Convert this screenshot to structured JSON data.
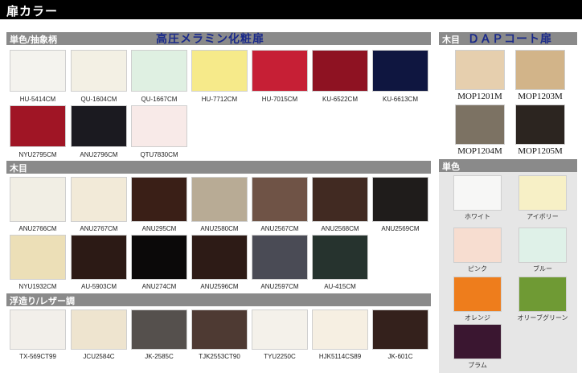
{
  "header": {
    "title": "扉カラー"
  },
  "melamine": {
    "label": "単色/抽象柄",
    "title": "高圧メラミン化粧扉",
    "items": [
      {
        "code": "HU-5414CM",
        "color": "#f4f3ee"
      },
      {
        "code": "QU-1604CM",
        "color": "#f3f0e4"
      },
      {
        "code": "QU-1667CM",
        "color": "#dff0e2"
      },
      {
        "code": "HU-7712CM",
        "color": "#f6ea8a"
      },
      {
        "code": "HU-7015CM",
        "color": "#c61f35"
      },
      {
        "code": "KU-6522CM",
        "color": "#8e1222"
      },
      {
        "code": "KU-6613CM",
        "color": "#0f1640"
      },
      {
        "code": "NYU2795CM",
        "color": "#a01525"
      },
      {
        "code": "ANU2796CM",
        "color": "#1b1a20"
      },
      {
        "code": "QTU7830CM",
        "color": "#f8eae8"
      }
    ]
  },
  "wood": {
    "label": "木目",
    "items": [
      {
        "code": "ANU2766CM",
        "color": "#f1eee4"
      },
      {
        "code": "ANU2767CM",
        "color": "#f2ead8"
      },
      {
        "code": "ANU295CM",
        "color": "#3a1f17"
      },
      {
        "code": "ANU2580CM",
        "color": "#b8ab95"
      },
      {
        "code": "ANU2567CM",
        "color": "#6f5346"
      },
      {
        "code": "ANU2568CM",
        "color": "#412a22"
      },
      {
        "code": "ANU2569CM",
        "color": "#1f1c1b"
      },
      {
        "code": "NYU1932CM",
        "color": "#ecdfb7"
      },
      {
        "code": "AU-5903CM",
        "color": "#2c1a15"
      },
      {
        "code": "ANU274CM",
        "color": "#0b0909"
      },
      {
        "code": "ANU2596CM",
        "color": "#2d1b16"
      },
      {
        "code": "ANU2597CM",
        "color": "#4a4b55"
      },
      {
        "code": "AU-415CM",
        "color": "#26332e"
      }
    ]
  },
  "leather": {
    "label": "浮造り/レザー調",
    "items": [
      {
        "code": "TX-569CT99",
        "color": "#f2efea"
      },
      {
        "code": "JCU2584C",
        "color": "#eee4cf"
      },
      {
        "code": "JK-2585C",
        "color": "#55504d"
      },
      {
        "code": "TJK2553CT90",
        "color": "#4e3a33"
      },
      {
        "code": "TYU2250C",
        "color": "#f4f1ea"
      },
      {
        "code": "HJK5114CS89",
        "color": "#f6efe2"
      },
      {
        "code": "JK-601C",
        "color": "#34211c"
      }
    ]
  },
  "dap": {
    "label": "木目",
    "title": "ＤＡＰコート扉",
    "items": [
      {
        "code": "MOP1201M",
        "color": "#e6cfae"
      },
      {
        "code": "MOP1203M",
        "color": "#d2b489"
      },
      {
        "code": "MOP1204M",
        "color": "#7c7263"
      },
      {
        "code": "MOP1205M",
        "color": "#2c2520"
      }
    ]
  },
  "solid": {
    "label": "単色",
    "items": [
      {
        "name": "ホワイト",
        "color": "#f7f7f6"
      },
      {
        "name": "アイボリー",
        "color": "#f7f0c6"
      },
      {
        "name": "ピンク",
        "color": "#f7ddd0"
      },
      {
        "name": "ブルー",
        "color": "#dff1e8"
      },
      {
        "name": "オレンジ",
        "color": "#ee7d1c"
      },
      {
        "name": "オリーブグリーン",
        "color": "#6f9a34"
      },
      {
        "name": "プラム",
        "color": "#3a1630"
      }
    ]
  }
}
